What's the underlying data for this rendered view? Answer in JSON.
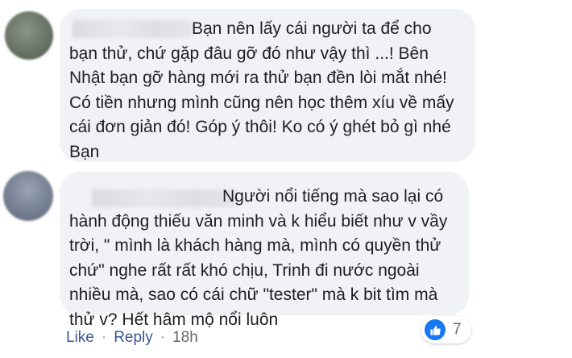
{
  "comments": [
    {
      "author": "",
      "text": "Bạn nên lấy cái người ta để cho bạn thử, chứ gặp đâu gỡ đó như vậy thì ...! Bên Nhật bạn gỡ hàng mới ra thử bạn đền lòi mắt nhé! Có tiền nhưng mình cũng nên học thêm xíu về mấy cái đơn giản đó! Góp ý thôi! Ko có ý ghét bỏ gì nhé Bạn"
    },
    {
      "author": "",
      "text": "Người nổi tiếng mà sao lại có hành động thiếu văn minh và k hiểu biết như v vầy trời, \" mình là khách hàng mà, mình có quyền thử chứ\" nghe rất rất khó chịu, Trinh đi nước ngoài nhiều mà, sao có cái chữ \"tester\" mà k bit tìm mà thử v? Hết hâm mộ nổi luôn",
      "actions": {
        "like_label": "Like",
        "separator": "·",
        "reply_label": "Reply",
        "timestamp": "18h"
      },
      "reactions": {
        "icon": "thumbs-up-icon",
        "count": "7",
        "color": "#1877f2"
      }
    }
  ]
}
